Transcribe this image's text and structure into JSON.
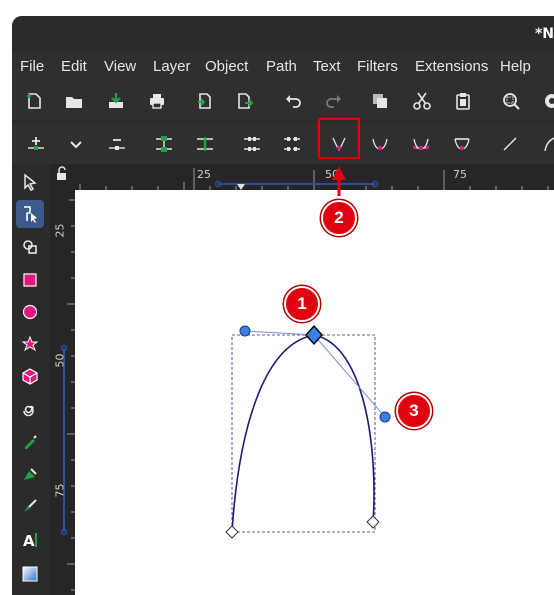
{
  "window": {
    "title": "*N"
  },
  "menubar": {
    "items": [
      {
        "id": "file",
        "label": "File"
      },
      {
        "id": "edit",
        "label": "Edit"
      },
      {
        "id": "view",
        "label": "View"
      },
      {
        "id": "layer",
        "label": "Layer"
      },
      {
        "id": "object",
        "label": "Object"
      },
      {
        "id": "path",
        "label": "Path"
      },
      {
        "id": "text",
        "label": "Text"
      },
      {
        "id": "filters",
        "label": "Filters"
      },
      {
        "id": "extensions",
        "label": "Extensions"
      },
      {
        "id": "help",
        "label": "Help"
      }
    ]
  },
  "toolbar_icons": [
    "new-document-icon",
    "open-file-icon",
    "save-icon",
    "print-icon",
    "import-icon",
    "export-icon",
    "undo-icon",
    "redo-icon",
    "duplicate-icon",
    "cut-icon",
    "paste-icon",
    "zoom-selection-icon",
    "zoom-drawing-icon"
  ],
  "node_toolbar_icons": [
    "insert-node-icon",
    "chevron-down-icon",
    "delete-node-icon",
    "join-nodes-icon",
    "break-path-icon",
    "join-segment-icon",
    "delete-segment-icon",
    "make-cusp-icon",
    "make-smooth-icon",
    "make-symmetric-icon",
    "auto-smooth-icon",
    "straight-segment-icon",
    "curve-segment-icon"
  ],
  "rulers": {
    "top_labels": [
      "25",
      "50",
      "75"
    ],
    "left_labels": [
      "25",
      "50",
      "75"
    ]
  },
  "tools": [
    "selector-icon",
    "node-tool-icon",
    "tweak-tool-icon",
    "rectangle-tool-icon",
    "ellipse-tool-icon",
    "star-tool-icon",
    "3d-box-tool-icon",
    "spiral-tool-icon",
    "pencil-tool-icon",
    "pen-tool-icon",
    "calligraphy-tool-icon",
    "text-tool-icon",
    "gradient-tool-icon"
  ],
  "annotations": {
    "badge_1": "1",
    "badge_2": "2",
    "badge_3": "3"
  },
  "colors": {
    "accent_red": "#e00010",
    "path_stroke": "#1a1a7a",
    "node_blue": "#3b7fe0",
    "handle_blue": "#2c6fd6",
    "guide_blue": "#2b4fa0",
    "tool_green": "#21a045",
    "tool_magenta": "#e0187a"
  }
}
